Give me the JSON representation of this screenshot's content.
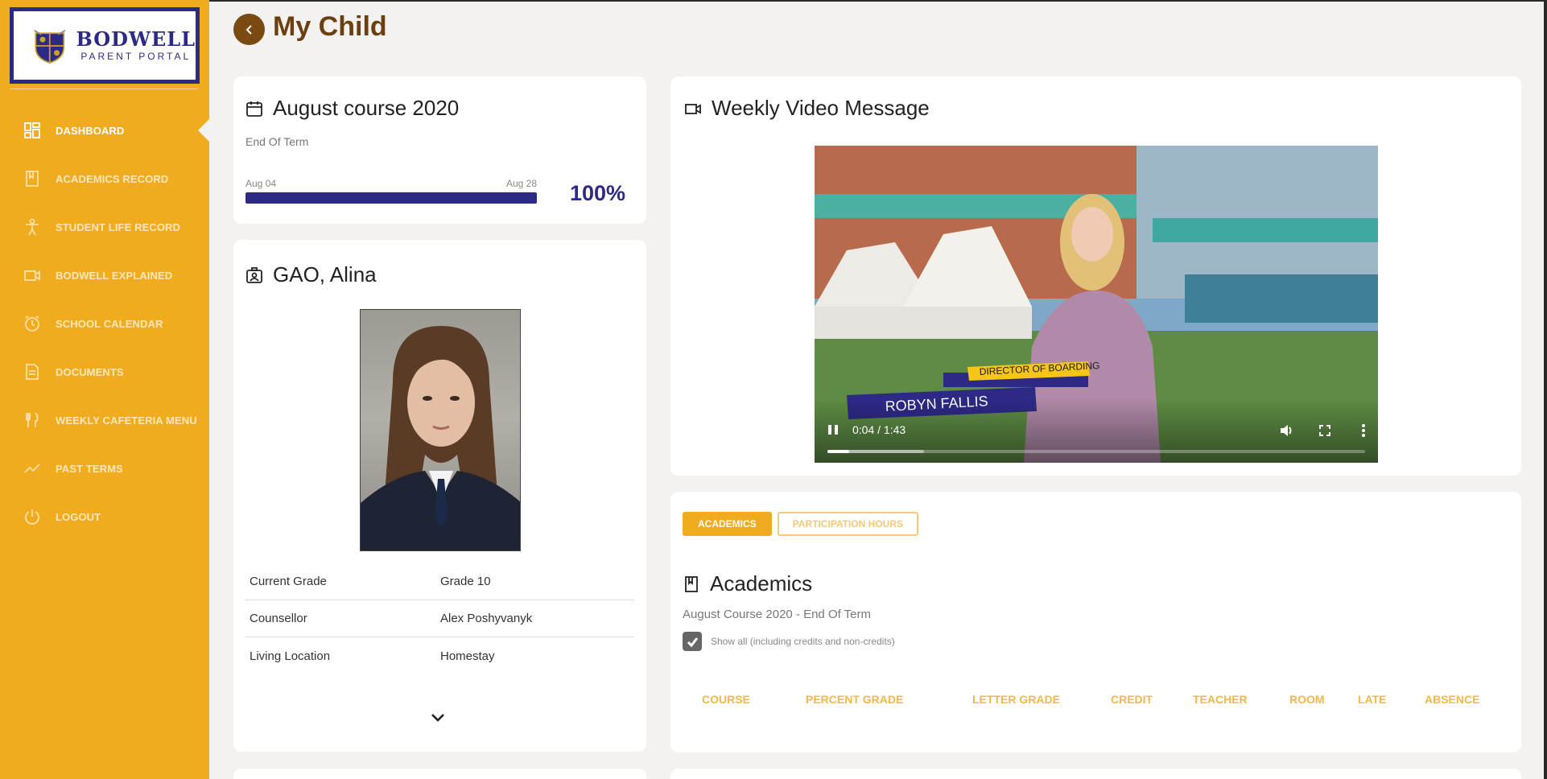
{
  "brand": {
    "title": "BODWELL",
    "subtitle": "PARENT PORTAL",
    "colors": {
      "sidebar": "#f0ab1e",
      "primary": "#2d2a86",
      "title": "#6b3f10"
    }
  },
  "sidebar": {
    "items": [
      {
        "label": "DASHBOARD",
        "icon": "dashboard-icon",
        "active": true
      },
      {
        "label": "ACADEMICS RECORD",
        "icon": "book-icon"
      },
      {
        "label": "STUDENT LIFE RECORD",
        "icon": "person-icon"
      },
      {
        "label": "BODWELL EXPLAINED",
        "icon": "video-camera-icon"
      },
      {
        "label": "SCHOOL CALENDAR",
        "icon": "alarm-clock-icon"
      },
      {
        "label": "DOCUMENTS",
        "icon": "document-icon"
      },
      {
        "label": "WEEKLY CAFETERIA MENU",
        "icon": "fork-knife-icon"
      },
      {
        "label": "PAST TERMS",
        "icon": "trend-line-icon"
      },
      {
        "label": "LOGOUT",
        "icon": "power-icon"
      }
    ]
  },
  "header": {
    "title": "My Child"
  },
  "course": {
    "title": "August course 2020",
    "status": "End Of Term",
    "start_date": "Aug 04",
    "end_date": "Aug 28",
    "progress": 1.0,
    "progress_label": "100%"
  },
  "student": {
    "name": "GAO, Alina",
    "rows": [
      {
        "label": "Current Grade",
        "value": "Grade 10"
      },
      {
        "label": "Counsellor",
        "value": "Alex Poshyvanyk"
      },
      {
        "label": "Living Location",
        "value": "Homestay"
      }
    ]
  },
  "video": {
    "title": "Weekly Video Message",
    "caption_role": "DIRECTOR OF BOARDING",
    "caption_name": "ROBYN FALLIS",
    "time": "0:04 / 1:43",
    "played": 0.04,
    "buffered": 0.18
  },
  "academics": {
    "tabs": [
      {
        "label": "ACADEMICS",
        "active": true
      },
      {
        "label": "PARTICIPATION HOURS",
        "active": false
      }
    ],
    "title": "Academics",
    "subtitle": "August Course 2020 - End Of Term",
    "show_all_label": "Show all (including credits and non-credits)",
    "show_all_checked": true,
    "columns": [
      "COURSE",
      "PERCENT GRADE",
      "LETTER GRADE",
      "CREDIT",
      "TEACHER",
      "ROOM",
      "LATE",
      "ABSENCE"
    ]
  }
}
